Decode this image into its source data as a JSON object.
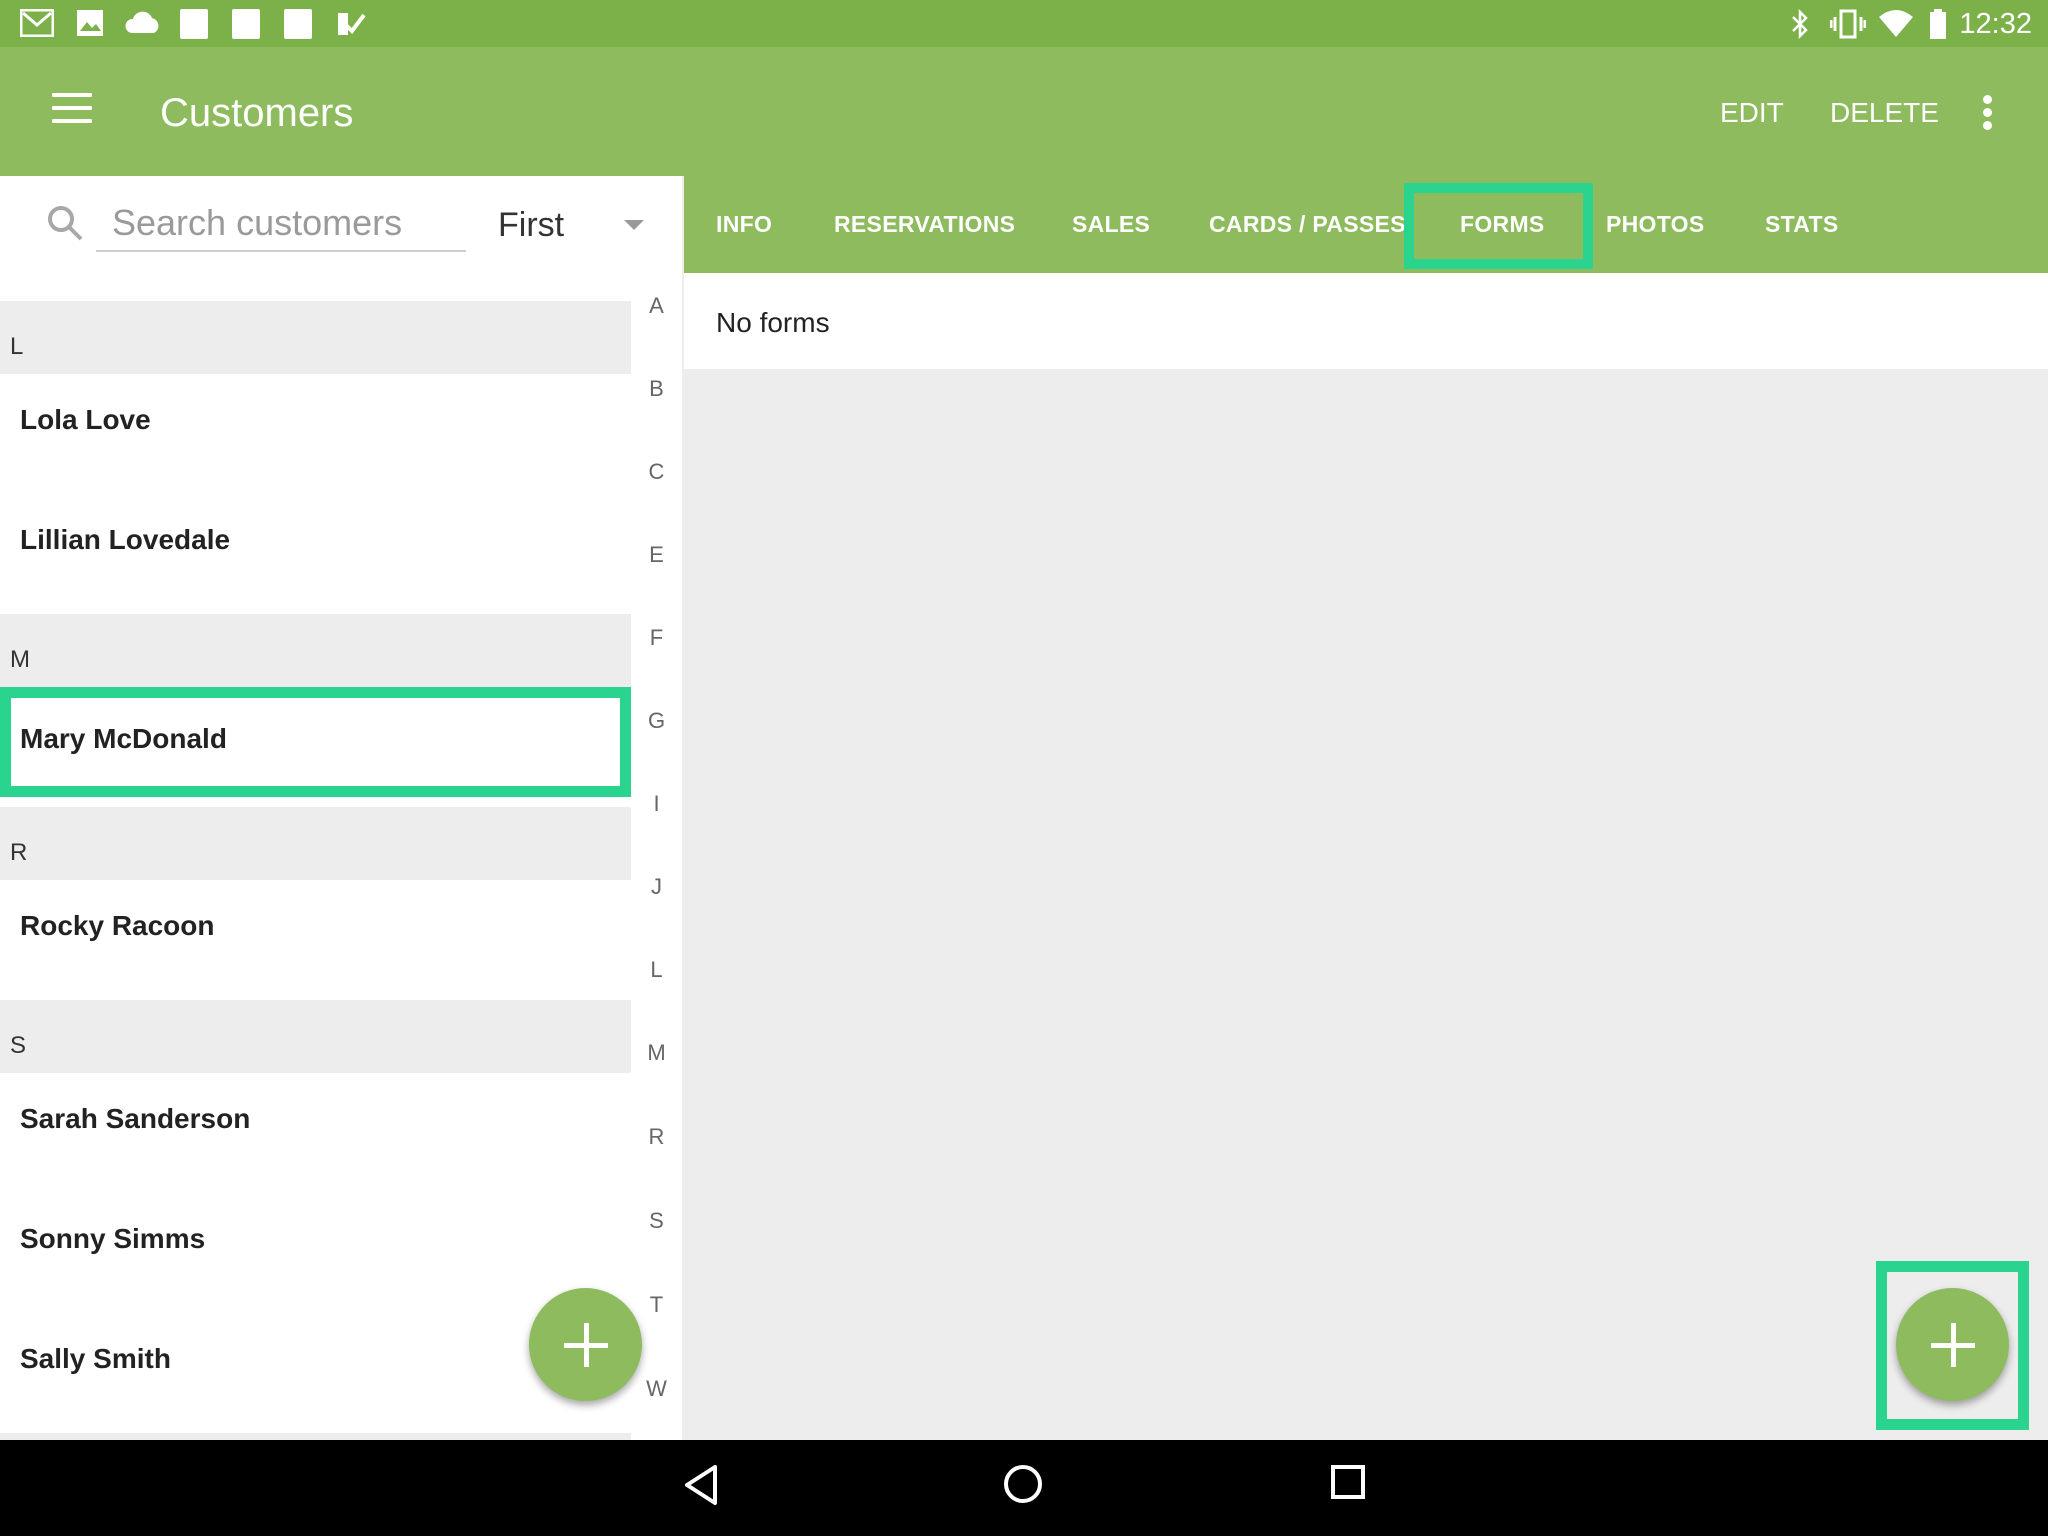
{
  "status_bar": {
    "time": "12:32",
    "icons": [
      "gmail-icon",
      "image-icon",
      "cloud-icon",
      "blank-notification-icon",
      "blank-notification-icon",
      "blank-notification-icon",
      "checkmark-app-icon",
      "bluetooth-icon",
      "vibrate-icon",
      "wifi-icon",
      "battery-icon"
    ]
  },
  "appbar": {
    "title": "Customers",
    "edit_label": "EDIT",
    "delete_label": "DELETE"
  },
  "search": {
    "placeholder": "Search customers",
    "sort_value": "First"
  },
  "customer_list": {
    "sections": [
      {
        "letter": "L",
        "customers": [
          "Lola Love",
          "Lillian Lovedale"
        ]
      },
      {
        "letter": "M",
        "customers": [
          "Mary McDonald"
        ]
      },
      {
        "letter": "R",
        "customers": [
          "Rocky Racoon"
        ]
      },
      {
        "letter": "S",
        "customers": [
          "Sarah Sanderson",
          "Sonny Simms",
          "Sally Smith"
        ]
      }
    ],
    "selected": "Mary McDonald"
  },
  "alphabet_index": [
    "A",
    "B",
    "C",
    "E",
    "F",
    "G",
    "I",
    "J",
    "L",
    "M",
    "R",
    "S",
    "T",
    "W"
  ],
  "tabs": [
    "INFO",
    "RESERVATIONS",
    "SALES",
    "CARDS / PASSES",
    "FORMS",
    "PHOTOS",
    "STATS"
  ],
  "active_tab": "FORMS",
  "content": {
    "empty_message": "No forms"
  },
  "colors": {
    "primary": "#8dbb5d",
    "status_bar": "#7cb048",
    "highlight": "#2ad38e"
  }
}
